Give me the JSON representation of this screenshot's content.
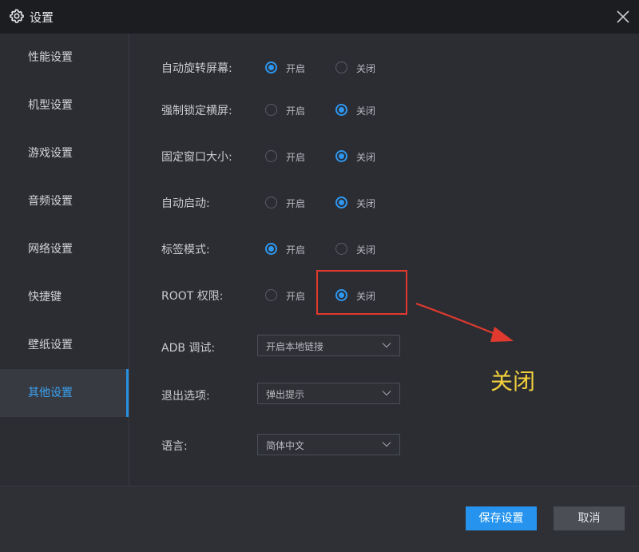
{
  "window": {
    "title": "设置",
    "icons": {
      "settings": "gear-icon",
      "close": "close-icon"
    }
  },
  "sidebar": {
    "items": [
      {
        "label": "性能设置",
        "active": false
      },
      {
        "label": "机型设置",
        "active": false
      },
      {
        "label": "游戏设置",
        "active": false
      },
      {
        "label": "音频设置",
        "active": false
      },
      {
        "label": "网络设置",
        "active": false
      },
      {
        "label": "快捷键",
        "active": false
      },
      {
        "label": "壁纸设置",
        "active": false
      },
      {
        "label": "其他设置",
        "active": true
      }
    ]
  },
  "settings": {
    "on_label": "开启",
    "off_label": "关闭",
    "rows": [
      {
        "label": "自动旋转屏幕:",
        "value": "on"
      },
      {
        "label": "强制锁定横屏:",
        "value": "off"
      },
      {
        "label": "固定窗口大小:",
        "value": "off"
      },
      {
        "label": "自动启动:",
        "value": "off"
      },
      {
        "label": "标签模式:",
        "value": "on"
      },
      {
        "label": "ROOT 权限:",
        "value": "off"
      }
    ],
    "selects": [
      {
        "label": "ADB 调试:",
        "value": "开启本地链接"
      },
      {
        "label": "退出选项:",
        "value": "弹出提示"
      },
      {
        "label": "语言:",
        "value": "简体中文"
      }
    ]
  },
  "annotation": {
    "text": "关闭",
    "color": "#f2d03b",
    "box_color": "#e03a2f"
  },
  "footer": {
    "save_label": "保存设置",
    "cancel_label": "取消"
  },
  "colors": {
    "accent": "#2694ee",
    "background": "#2b2d33",
    "titlebar": "#1c1d21"
  }
}
